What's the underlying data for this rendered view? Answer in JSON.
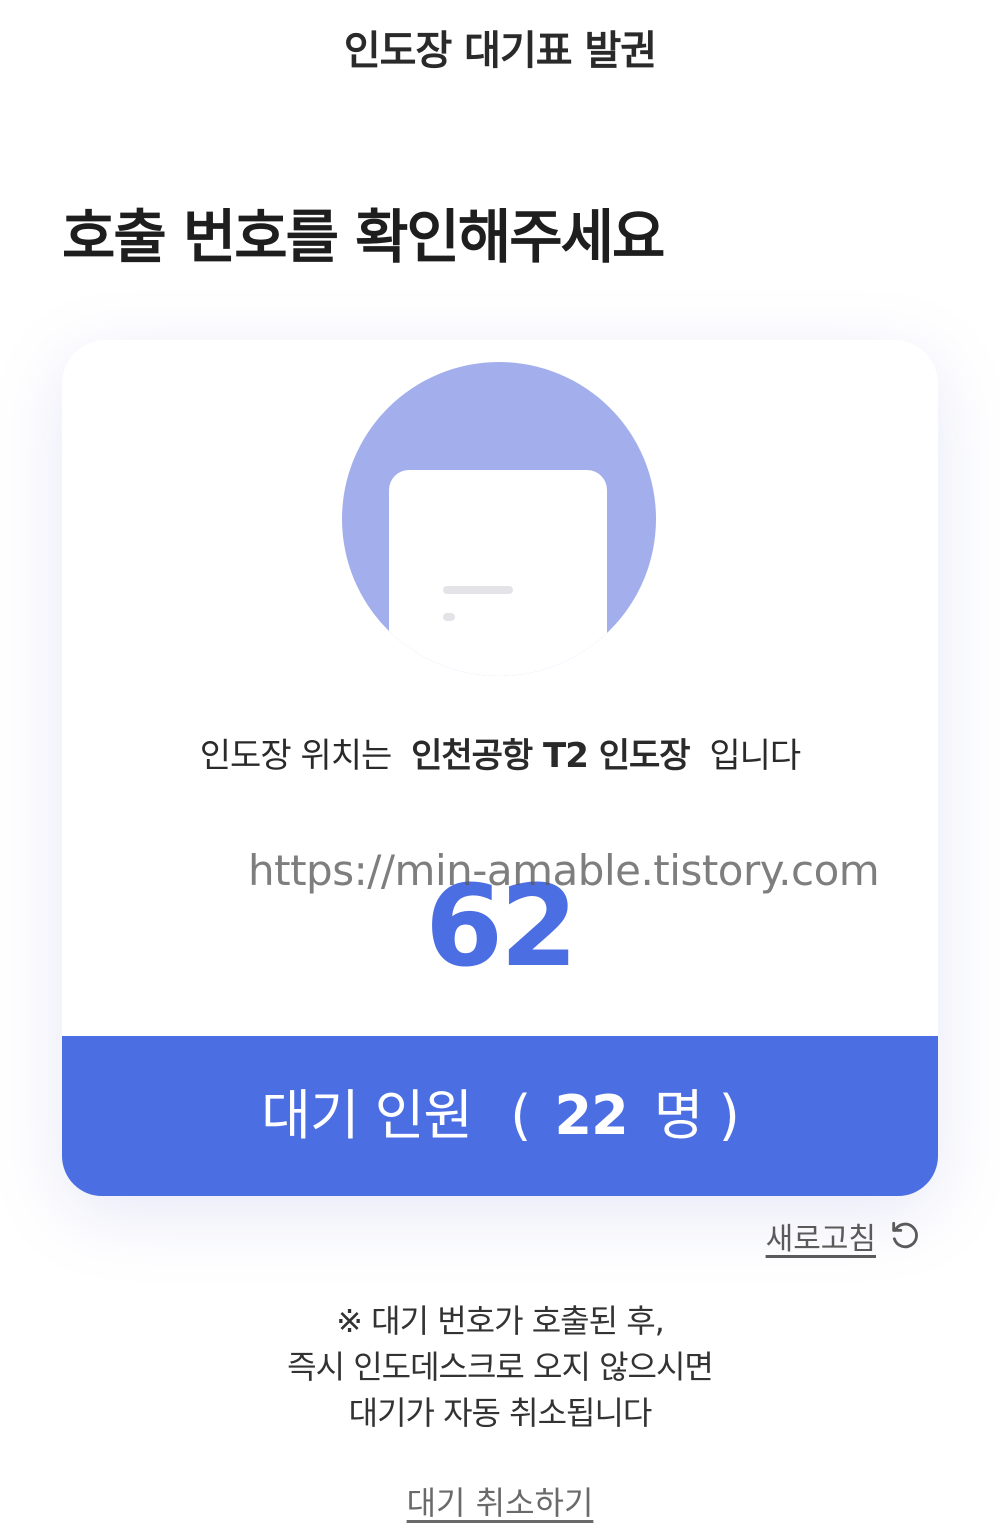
{
  "header": {
    "title": "인도장 대기표 발권"
  },
  "main": {
    "heading": "호출 번호를 확인해주세요"
  },
  "card": {
    "location_prefix": "인도장 위치는",
    "location_name": "인천공항 T2 인도장",
    "location_suffix": "입니다",
    "call_number": "62",
    "watermark": "https://min-amable.tistory.com",
    "wait_label": "대기 인원",
    "wait_open": "(",
    "wait_count": "22",
    "wait_unit": "명",
    "wait_close": ")",
    "accent_color": "#4b6ee3",
    "illustration_color": "#a3aeec"
  },
  "refresh": {
    "label": "새로고침",
    "icon": "refresh-icon"
  },
  "notice": {
    "line1": "※ 대기 번호가 호출된 후,",
    "line2": "즉시 인도데스크로 오지 않으시면",
    "line3": "대기가 자동 취소됩니다"
  },
  "cancel": {
    "label": "대기 취소하기"
  }
}
